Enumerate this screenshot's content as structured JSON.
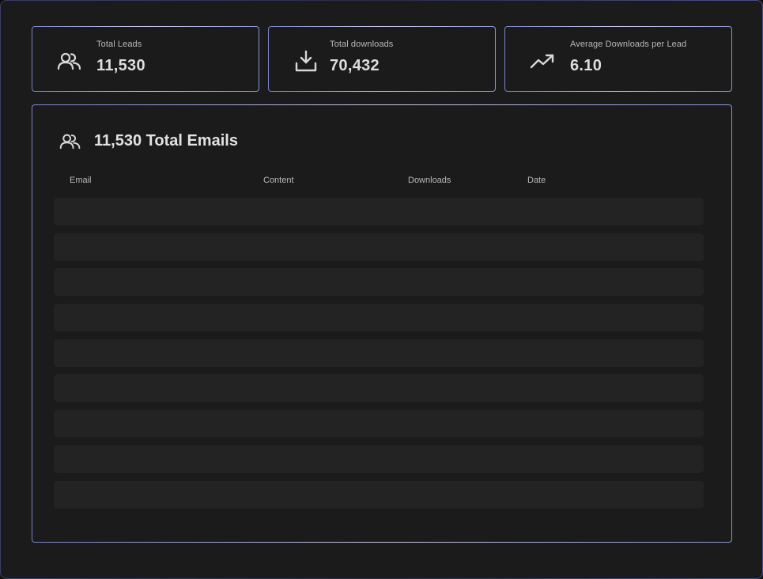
{
  "stats": [
    {
      "label": "Total Leads",
      "value": "11,530",
      "icon": "users-icon"
    },
    {
      "label": "Total downloads",
      "value": "70,432",
      "icon": "download-icon"
    },
    {
      "label": "Average Downloads per Lead",
      "value": "6.10",
      "icon": "trending-up-icon"
    }
  ],
  "emails_section": {
    "title": "11,530 Total Emails",
    "icon": "users-icon",
    "columns": [
      "Email",
      "Content",
      "Downloads",
      "Date"
    ],
    "rows": [
      {
        "email": "",
        "content": "",
        "downloads": "",
        "date": ""
      },
      {
        "email": "",
        "content": "",
        "downloads": "",
        "date": ""
      },
      {
        "email": "",
        "content": "",
        "downloads": "",
        "date": ""
      },
      {
        "email": "",
        "content": "",
        "downloads": "",
        "date": ""
      },
      {
        "email": "",
        "content": "",
        "downloads": "",
        "date": ""
      },
      {
        "email": "",
        "content": "",
        "downloads": "",
        "date": ""
      },
      {
        "email": "",
        "content": "",
        "downloads": "",
        "date": ""
      },
      {
        "email": "",
        "content": "",
        "downloads": "",
        "date": ""
      },
      {
        "email": "",
        "content": "",
        "downloads": "",
        "date": ""
      }
    ]
  },
  "colors": {
    "background": "#1b1b1b",
    "row_placeholder": "#232323",
    "text_primary": "#dedede",
    "text_secondary": "#b9b9b9",
    "border_accent": "#8c96d4"
  }
}
